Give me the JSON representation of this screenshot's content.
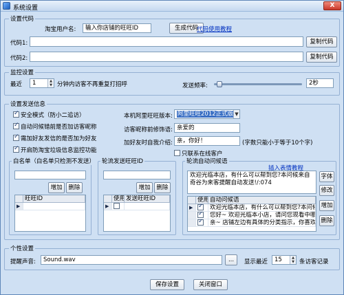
{
  "window": {
    "title": "系统设置",
    "close": "X"
  },
  "code": {
    "group_title": "设置代码",
    "account_label": "淘宝用户名:",
    "account_value": "输入你店铺的旺旺ID",
    "generate_button": "生成代码",
    "usage_link": "代码使用教程",
    "code1_label": "代码1:",
    "code2_label": "代码2:",
    "copy_button": "复制代码"
  },
  "monitor": {
    "group_title": "监控设置",
    "recent_label": "最近",
    "recent_value": "1",
    "minutes_text": "分钟内访客不再重复打招呼",
    "freq_label": "发送频率:",
    "freq_value": "2秒",
    "freq_level": 0.03
  },
  "send": {
    "group_title": "设置发送信息",
    "options": [
      {
        "label": "安全模式（防小二追访）",
        "checked": true
      },
      {
        "label": "自动问候错前是否加访客昵称",
        "checked": true
      },
      {
        "label": "需加好友发信的是否加为好友",
        "checked": true
      },
      {
        "label": "开启防淘宝垃圾信息监控功能",
        "checked": true
      }
    ],
    "version_label": "本机阿里旺旺版本:",
    "version_value": "阿里旺旺2012正式版本",
    "nick_label": "访客昵称前修饰语:",
    "nick_value": "亲爱的",
    "friend_label": "加好友时自我介绍:",
    "friend_value": "亲，你好！",
    "friend_hint": "(字数只能小于等于10个字)",
    "only_existing_label": "只联系在线客户",
    "only_existing_checked": false
  },
  "whitelist": {
    "title": "白名单（白名单只检测不发送）",
    "add": "增加",
    "delete": "删除",
    "column": "旺旺ID",
    "marker": "▶"
  },
  "rotation_accounts": {
    "title": "轮流发送旺旺ID",
    "add": "增加",
    "delete": "删除",
    "col_use": "使用",
    "col_id": "发送旺旺ID",
    "marker": "▶"
  },
  "greetings": {
    "title": "轮流自动问候语",
    "insert_link": "插入表情教程",
    "editor_text": "欢迎光临本店，有什么可以帮到您?本问候来自奇谷为来客提醒自动发送!/:074",
    "font_button": "字体",
    "edit_button": "修改",
    "add_button": "增加",
    "delete_button": "删除",
    "col_use": "使用",
    "col_text": "自动问候语",
    "marker": "▶",
    "rows": [
      {
        "text": "欢迎光临本店，有什么可以帮到您?本问候来",
        "checked": true
      },
      {
        "text": "您好~ 欢迎光临本小店，请问您现看中哪些",
        "checked": true
      },
      {
        "text": "亲~ 店铺左边有具体的分类指示，你喜欢哪",
        "checked": true
      }
    ]
  },
  "personal": {
    "group_title": "个性设置",
    "sound_label": "提醒声音:",
    "sound_value": "Sound.wav",
    "browse": "...",
    "show_label": "显示最近",
    "show_value": "15",
    "show_suffix": "条访客记录"
  },
  "footer": {
    "save": "保存设置",
    "close": "关闭窗口"
  }
}
